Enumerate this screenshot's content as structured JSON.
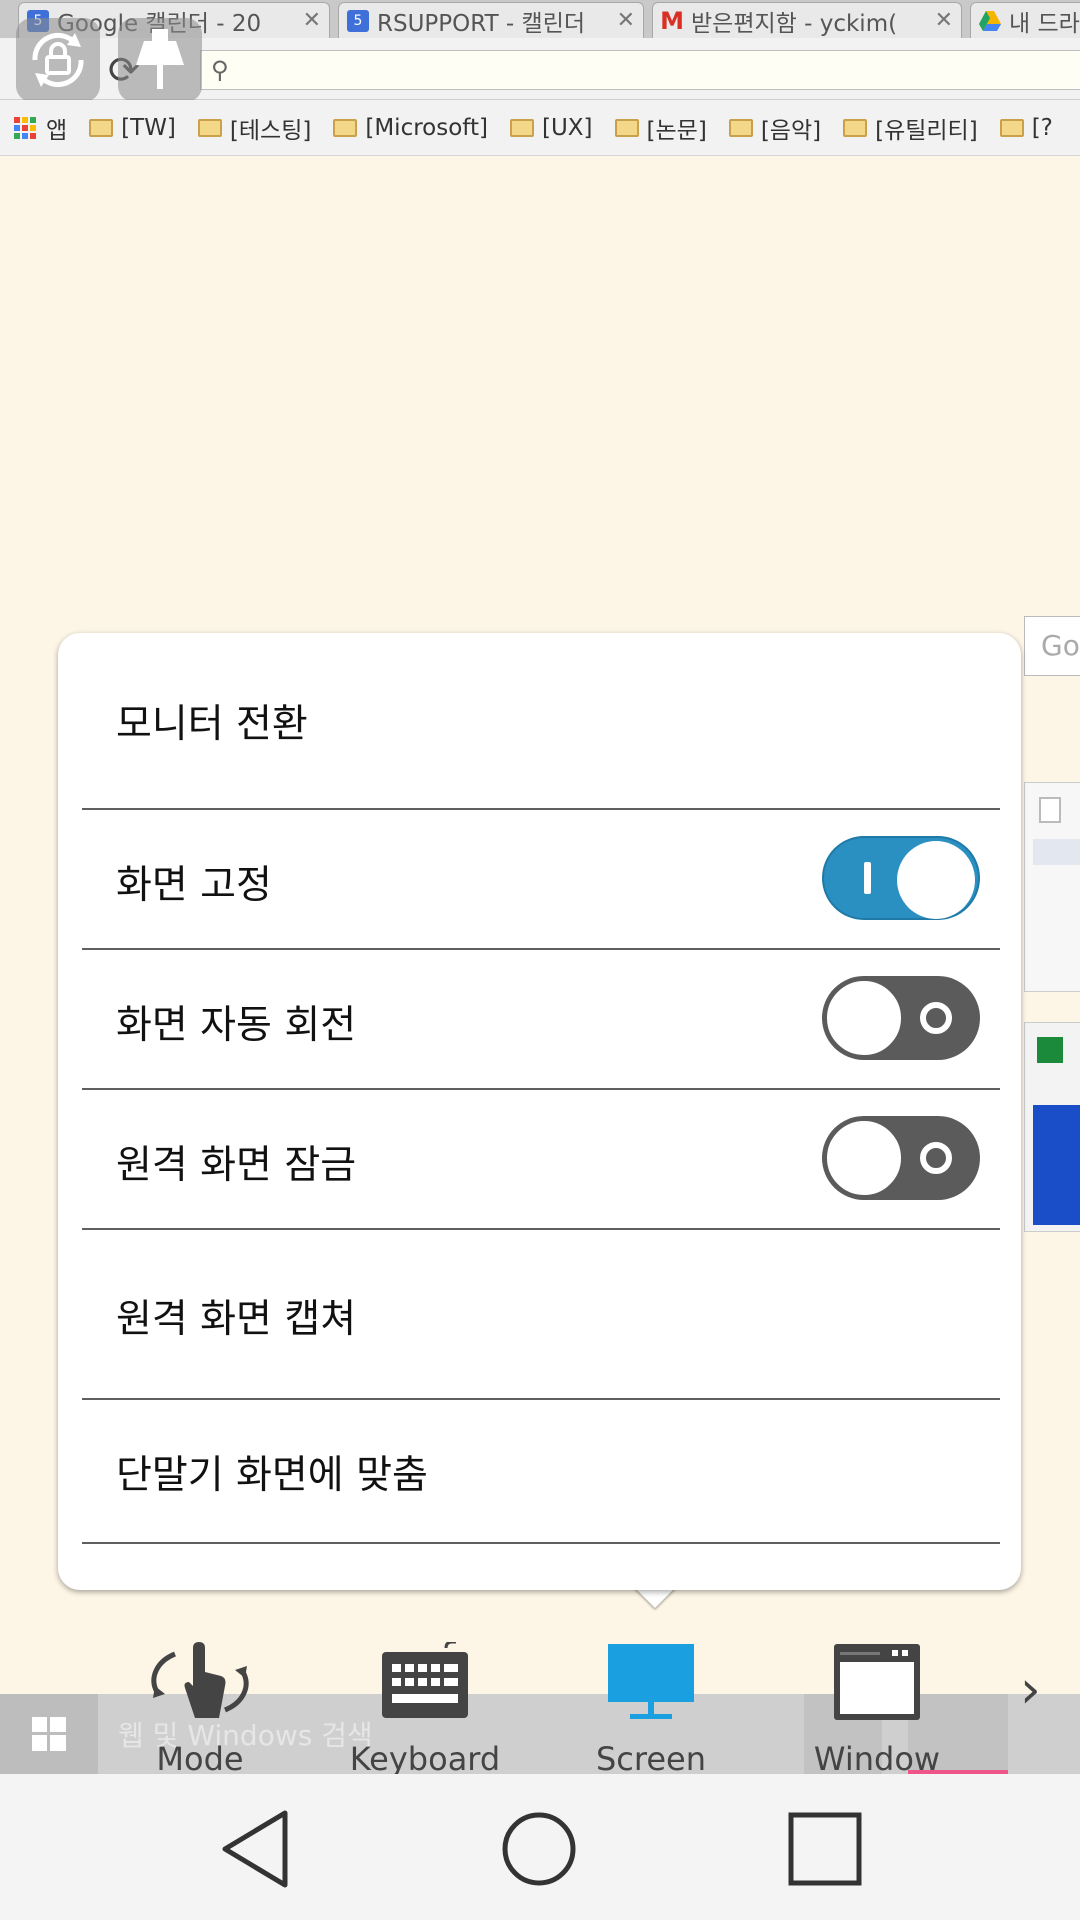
{
  "browser": {
    "tabs": [
      {
        "title": "Google 캘린더 - 20",
        "favicon": "calendar-icon",
        "color": "#3f6fd8"
      },
      {
        "title": "RSUPPORT - 캘린더",
        "favicon": "calendar-icon",
        "color": "#3f6fd8"
      },
      {
        "title": "받은편지함 - yckim(",
        "favicon": "gmail-icon",
        "color": "#d93025"
      },
      {
        "title": "내 드라",
        "favicon": "drive-icon",
        "color": "#1fa463"
      }
    ],
    "bookmarks": {
      "apps_label": "앱",
      "folders": [
        "[TW]",
        "[테스팅]",
        "[Microsoft]",
        "[UX]",
        "[논문]",
        "[음악]",
        "[유틸리티]",
        "[?"
      ]
    },
    "peek_search_text": "Goo"
  },
  "popup": {
    "items": [
      {
        "label": "모니터 전환",
        "has_toggle": false
      },
      {
        "label": "화면 고정",
        "has_toggle": true,
        "on": true
      },
      {
        "label": "화면 자동 회전",
        "has_toggle": true,
        "on": false
      },
      {
        "label": "원격 화면 잠금",
        "has_toggle": true,
        "on": false
      },
      {
        "label": "원격 화면 캡쳐",
        "has_toggle": false
      },
      {
        "label": "단말기 화면에 맞춤",
        "has_toggle": false
      }
    ]
  },
  "taskbar": {
    "search_text": "웹 및 Windows 검색"
  },
  "modebar": {
    "items": [
      {
        "label": "Mode",
        "icon": "hand-rotate-icon",
        "active": false
      },
      {
        "label": "Keyboard",
        "icon": "keyboard-icon",
        "active": false
      },
      {
        "label": "Screen",
        "icon": "monitor-icon",
        "active": true
      },
      {
        "label": "Window",
        "icon": "window-icon",
        "active": false
      }
    ],
    "accent_color": "#1a9fe0"
  },
  "navbar": {
    "buttons": [
      "back",
      "home",
      "recents"
    ]
  }
}
